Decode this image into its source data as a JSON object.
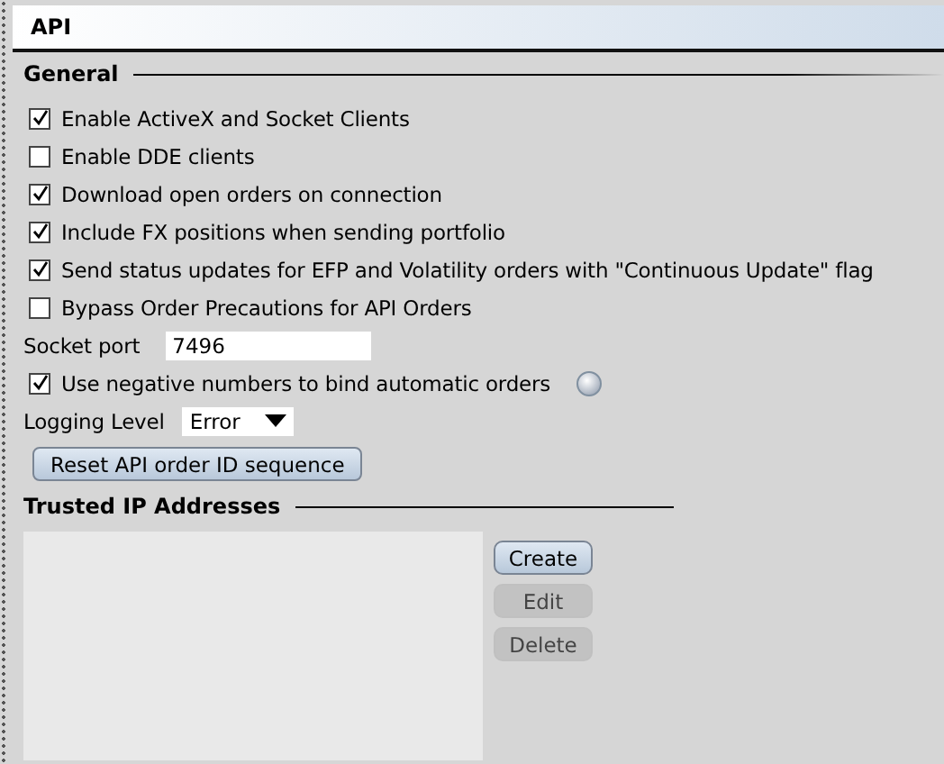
{
  "panel": {
    "title": "API"
  },
  "general": {
    "heading": "General",
    "items": [
      {
        "kind": "checkbox",
        "label": "Enable ActiveX and Socket Clients",
        "checked": true
      },
      {
        "kind": "checkbox",
        "label": "Enable DDE clients",
        "checked": false
      },
      {
        "kind": "checkbox",
        "label": "Download open orders on connection",
        "checked": true
      },
      {
        "kind": "checkbox",
        "label": "Include FX positions when sending portfolio",
        "checked": true
      },
      {
        "kind": "checkbox",
        "label": "Send status updates for EFP and Volatility orders with \"Continuous Update\" flag",
        "checked": true
      },
      {
        "kind": "checkbox",
        "label": "Bypass Order Precautions for API Orders",
        "checked": false
      },
      {
        "kind": "field",
        "label": "Socket port",
        "value": "7496"
      },
      {
        "kind": "checkbox",
        "label": "Use negative numbers to bind automatic orders",
        "checked": true,
        "help": true
      },
      {
        "kind": "select",
        "label": "Logging Level",
        "value": "Error"
      },
      {
        "kind": "button",
        "label": "Reset API order ID sequence"
      }
    ]
  },
  "trusted": {
    "heading": "Trusted IP Addresses",
    "buttons": [
      {
        "label": "Create",
        "disabled": false
      },
      {
        "label": "Edit",
        "disabled": true
      },
      {
        "label": "Delete",
        "disabled": true
      }
    ]
  }
}
